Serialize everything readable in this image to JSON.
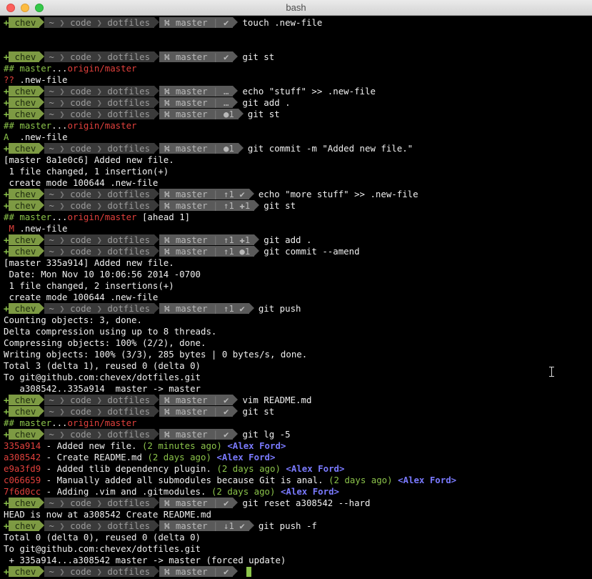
{
  "window": {
    "title": "bash"
  },
  "prompt": {
    "plus": "+",
    "user": "chev",
    "home": "~",
    "path1": "code",
    "path2": "dotfiles",
    "branch_icon": "⛕",
    "branch": "master"
  },
  "lines": [
    {
      "kind": "prompt",
      "status": "✔",
      "cmd": "touch .new-file"
    },
    {
      "kind": "blank"
    },
    {
      "kind": "blank"
    },
    {
      "kind": "prompt",
      "status": "✔",
      "cmd": "git st"
    },
    {
      "kind": "track",
      "local": "## master",
      "dots": "...",
      "remote": "origin/master",
      "extra": ""
    },
    {
      "kind": "status",
      "code": "??",
      "codecolor": "r",
      "file": " .new-file"
    },
    {
      "kind": "prompt",
      "status": "…",
      "cmd": "echo \"stuff\" >> .new-file"
    },
    {
      "kind": "prompt",
      "status": "…",
      "cmd": "git add ."
    },
    {
      "kind": "prompt",
      "status": "●1",
      "cmd": "git st"
    },
    {
      "kind": "track",
      "local": "## master",
      "dots": "...",
      "remote": "origin/master",
      "extra": ""
    },
    {
      "kind": "status",
      "code": "A",
      "codecolor": "g",
      "file": "  .new-file"
    },
    {
      "kind": "prompt",
      "status": "●1",
      "cmd": "git commit -m \"Added new file.\""
    },
    {
      "kind": "text",
      "text": "[master 8a1e0c6] Added new file."
    },
    {
      "kind": "text",
      "text": " 1 file changed, 1 insertion(+)"
    },
    {
      "kind": "text",
      "text": " create mode 100644 .new-file"
    },
    {
      "kind": "prompt",
      "status": "↑1 ✔",
      "cmd": "echo \"more stuff\" >> .new-file"
    },
    {
      "kind": "prompt",
      "status": "↑1 ✚1",
      "cmd": "git st"
    },
    {
      "kind": "track",
      "local": "## master",
      "dots": "...",
      "remote": "origin/master",
      "extra": " [ahead 1]"
    },
    {
      "kind": "status",
      "code": " M",
      "codecolor": "r",
      "file": " .new-file"
    },
    {
      "kind": "prompt",
      "status": "↑1 ✚1",
      "cmd": "git add ."
    },
    {
      "kind": "prompt",
      "status": "↑1 ●1",
      "cmd": "git commit --amend"
    },
    {
      "kind": "text",
      "text": "[master 335a914] Added new file."
    },
    {
      "kind": "text",
      "text": " Date: Mon Nov 10 10:06:56 2014 -0700"
    },
    {
      "kind": "text",
      "text": " 1 file changed, 2 insertions(+)"
    },
    {
      "kind": "text",
      "text": " create mode 100644 .new-file"
    },
    {
      "kind": "prompt",
      "status": "↑1 ✔",
      "cmd": "git push"
    },
    {
      "kind": "text",
      "text": "Counting objects: 3, done."
    },
    {
      "kind": "text",
      "text": "Delta compression using up to 8 threads."
    },
    {
      "kind": "text",
      "text": "Compressing objects: 100% (2/2), done."
    },
    {
      "kind": "text",
      "text": "Writing objects: 100% (3/3), 285 bytes | 0 bytes/s, done."
    },
    {
      "kind": "text",
      "text": "Total 3 (delta 1), reused 0 (delta 0)"
    },
    {
      "kind": "text",
      "text": "To git@github.com:chevex/dotfiles.git"
    },
    {
      "kind": "text",
      "text": "   a308542..335a914  master -> master"
    },
    {
      "kind": "prompt",
      "status": "✔",
      "cmd": "vim README.md"
    },
    {
      "kind": "prompt",
      "status": "✔",
      "cmd": "git st"
    },
    {
      "kind": "track",
      "local": "## master",
      "dots": "...",
      "remote": "origin/master",
      "extra": ""
    },
    {
      "kind": "prompt",
      "status": "✔",
      "cmd": "git lg -5"
    },
    {
      "kind": "log",
      "hash": "335a914",
      "msg": " - Added new file. ",
      "time": "(2 minutes ago)",
      "author": "<Alex Ford>"
    },
    {
      "kind": "log",
      "hash": "a308542",
      "msg": " - Create README.md ",
      "time": "(2 days ago)",
      "author": "<Alex Ford>"
    },
    {
      "kind": "log",
      "hash": "e9a3fd9",
      "msg": " - Added tlib dependency plugin. ",
      "time": "(2 days ago)",
      "author": "<Alex Ford>"
    },
    {
      "kind": "log",
      "hash": "c066659",
      "msg": " - Manually added all submodules because Git is anal. ",
      "time": "(2 days ago)",
      "author": "<Alex Ford>"
    },
    {
      "kind": "log",
      "hash": "7f6d0cc",
      "msg": " - Adding .vim and .gitmodules. ",
      "time": "(2 days ago)",
      "author": "<Alex Ford>"
    },
    {
      "kind": "prompt",
      "status": "✔",
      "cmd": "git reset a308542 --hard"
    },
    {
      "kind": "text",
      "text": "HEAD is now at a308542 Create README.md"
    },
    {
      "kind": "prompt",
      "status": "↓1 ✔",
      "cmd": "git push -f"
    },
    {
      "kind": "text",
      "text": "Total 0 (delta 0), reused 0 (delta 0)"
    },
    {
      "kind": "text",
      "text": "To git@github.com:chevex/dotfiles.git"
    },
    {
      "kind": "text",
      "text": " + 335a914...a308542 master -> master (forced update)"
    },
    {
      "kind": "prompt",
      "status": "✔",
      "cmd": "",
      "cursor": true
    }
  ]
}
